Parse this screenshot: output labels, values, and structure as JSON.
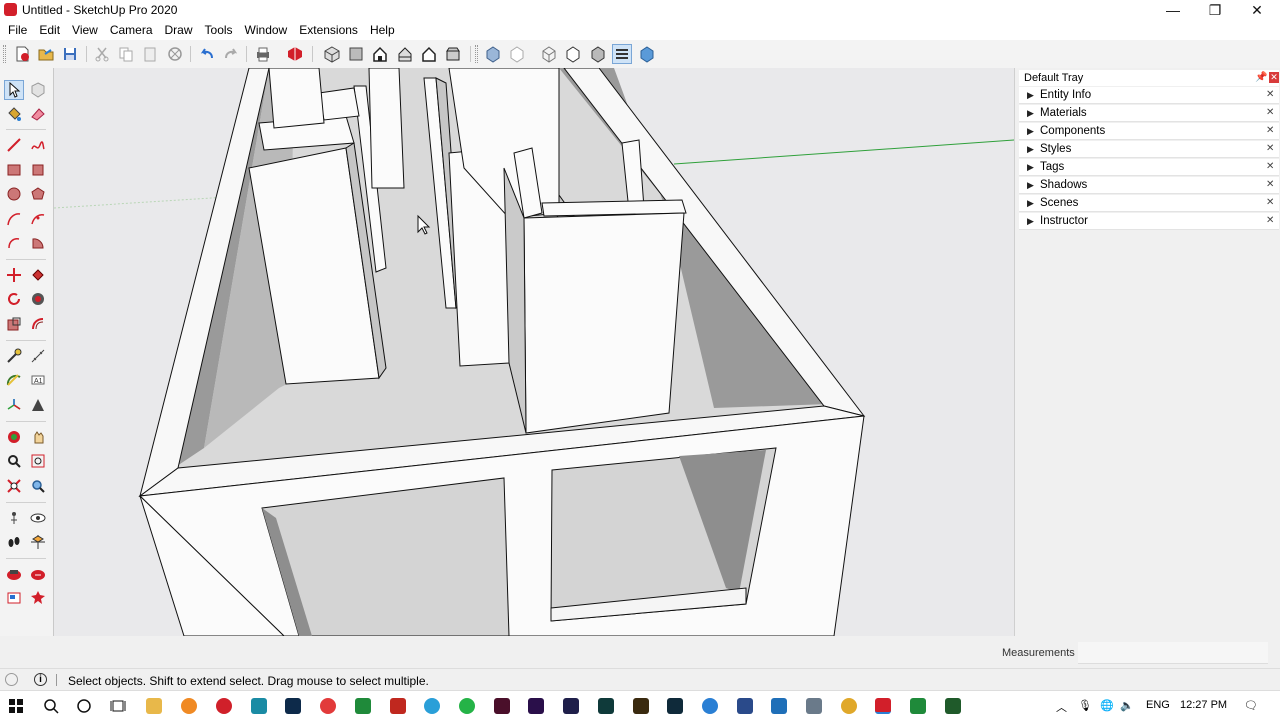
{
  "window": {
    "title": "Untitled - SketchUp Pro 2020",
    "controls": {
      "minimize": "—",
      "maximize": "❐",
      "close": "✕"
    }
  },
  "menu": [
    "File",
    "Edit",
    "View",
    "Camera",
    "Draw",
    "Tools",
    "Window",
    "Extensions",
    "Help"
  ],
  "tray": {
    "title": "Default Tray",
    "panels": [
      "Entity Info",
      "Materials",
      "Components",
      "Styles",
      "Tags",
      "Shadows",
      "Scenes",
      "Instructor"
    ]
  },
  "measurements_label": "Measurements",
  "status": {
    "text": "Select objects. Shift to extend select. Drag mouse to select multiple.",
    "info_icon": "i"
  },
  "taskbar": {
    "language": "ENG",
    "time": "12:27 PM"
  },
  "colors": {
    "accent_red": "#d21f2a",
    "axis_green": "#2fa03a",
    "wall_white": "#fbfbfb",
    "floor_grey": "#d9d9d9",
    "shadow_grey": "#9a9a9a"
  }
}
